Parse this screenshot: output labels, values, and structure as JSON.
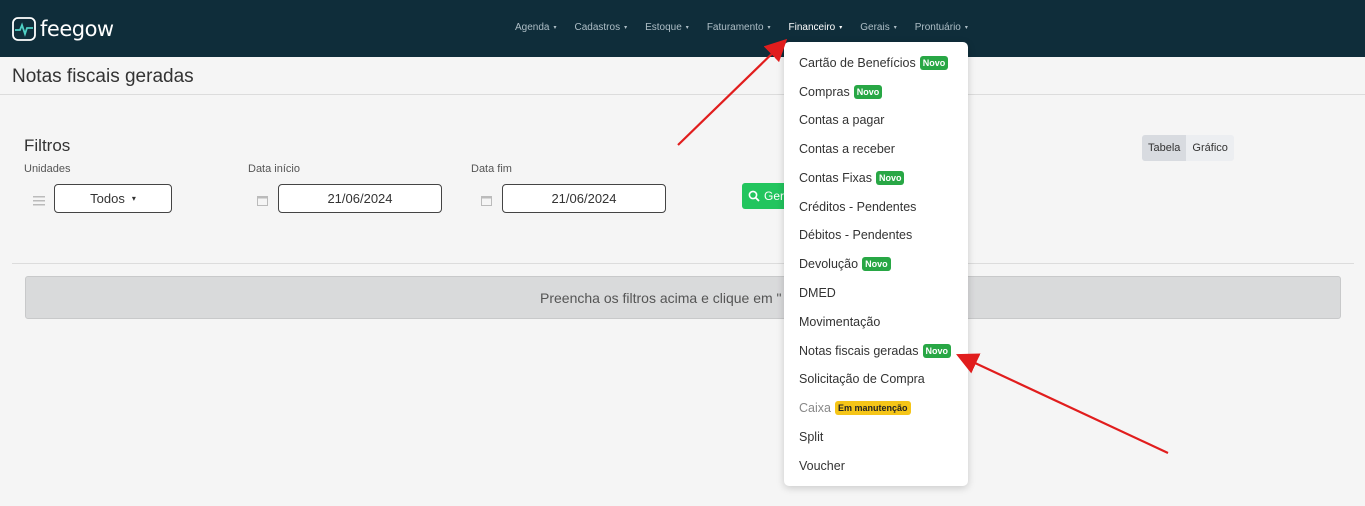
{
  "app": {
    "logo_text": "feegow"
  },
  "nav": {
    "items": [
      {
        "label": "Agenda"
      },
      {
        "label": "Cadastros"
      },
      {
        "label": "Estoque"
      },
      {
        "label": "Faturamento"
      },
      {
        "label": "Financeiro"
      },
      {
        "label": "Gerais"
      },
      {
        "label": "Prontuário"
      }
    ],
    "caret": "▾"
  },
  "page": {
    "title": "Notas fiscais geradas"
  },
  "filters": {
    "title": "Filtros",
    "unidades_label": "Unidades",
    "unidades_value": "Todos",
    "data_inicio_label": "Data início",
    "data_inicio_value": "21/06/2024",
    "data_fim_label": "Data fim",
    "data_fim_value": "21/06/2024",
    "generate_label": "Gera"
  },
  "view_toggle": {
    "table": "Tabela",
    "chart": "Gráfico"
  },
  "info_message": "Preencha os filtros acima e clique em \"",
  "dropdown": {
    "items": [
      {
        "label": "Cartão de Benefícios",
        "badge": "Novo"
      },
      {
        "label": "Compras",
        "badge": "Novo"
      },
      {
        "label": "Contas a pagar"
      },
      {
        "label": "Contas a receber"
      },
      {
        "label": "Contas Fixas",
        "badge": "Novo"
      },
      {
        "label": "Créditos - Pendentes"
      },
      {
        "label": "Débitos - Pendentes"
      },
      {
        "label": "Devolução",
        "badge": "Novo"
      },
      {
        "label": "DMED"
      },
      {
        "label": "Movimentação"
      },
      {
        "label": "Notas fiscais geradas",
        "badge": "Novo"
      },
      {
        "label": "Solicitação de Compra"
      },
      {
        "label": "Caixa",
        "badge": "Em manutenção"
      },
      {
        "label": "Split"
      },
      {
        "label": "Voucher"
      }
    ]
  },
  "colors": {
    "topbar": "#0f2d3a",
    "accent_green": "#22c55e",
    "badge_green": "#28a745",
    "badge_yellow": "#f5c518",
    "arrow": "#e11d1d"
  }
}
